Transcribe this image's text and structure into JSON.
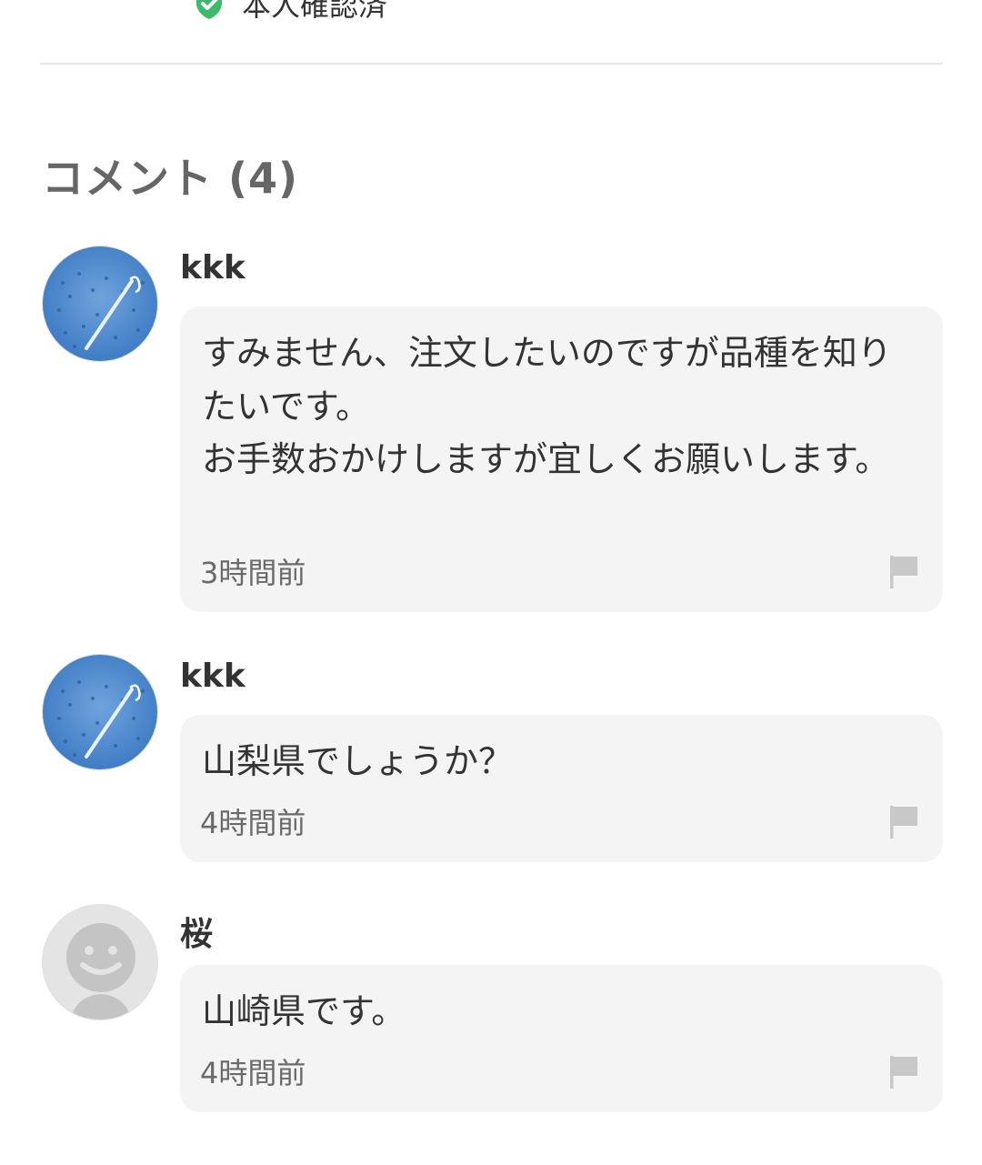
{
  "profile": {
    "verified_label": "本人確認済"
  },
  "comments_section": {
    "title": "コメント (4)"
  },
  "comments": [
    {
      "username": "kkk",
      "avatar": "photo-avatar",
      "body": "すみません、注文したいのですが品種を知りたいです。\nお手数おかけしますが宜しくお願いします。",
      "time": "3時間前",
      "report_icon": "flag-icon"
    },
    {
      "username": "kkk",
      "avatar": "photo-avatar",
      "body": "山梨県でしょうか？",
      "time": "4時間前",
      "report_icon": "flag-icon"
    },
    {
      "username": "桜",
      "avatar": "default-avatar",
      "body": "山崎県です。",
      "time": "4時間前",
      "report_icon": "flag-icon"
    }
  ],
  "colors": {
    "verified_green": "#3dbb6c",
    "bubble_bg": "#f4f4f4",
    "flag_gray": "#c8c8c8",
    "section_title": "#666666"
  }
}
